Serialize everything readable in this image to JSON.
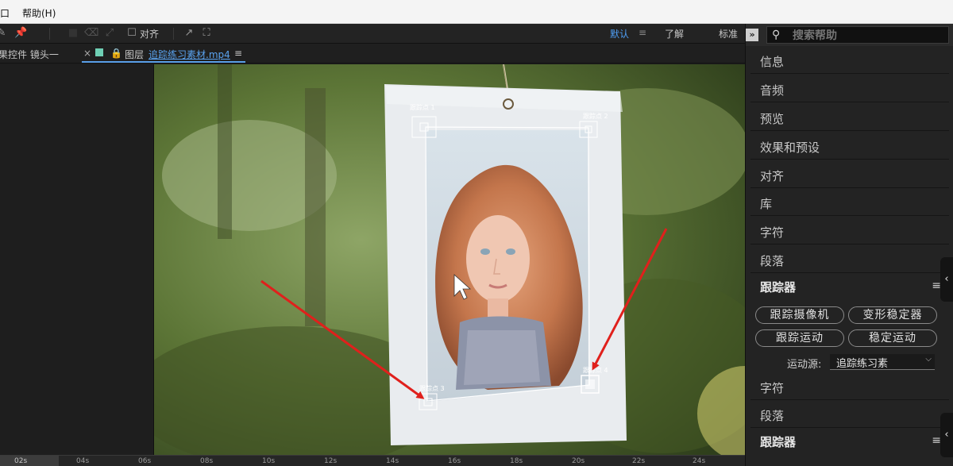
{
  "menubar": {
    "window": "窗口",
    "help": "帮助(H)"
  },
  "toolbar": {
    "align_label": "对齐",
    "workspaces": {
      "default": "默认",
      "learn": "了解",
      "standard": "标准"
    }
  },
  "tabs": {
    "left": "效果控件 镜头一",
    "layer_prefix": "图层",
    "layer_name": "追踪练习素材.mp4"
  },
  "viewer": {
    "track_points": [
      "跟踪点 1",
      "跟踪点 2",
      "跟踪点 3",
      "跟踪点 4"
    ]
  },
  "timeline": {
    "current": "02s",
    "ticks": [
      "04s",
      "06s",
      "08s",
      "10s",
      "12s",
      "14s",
      "16s",
      "18s",
      "20s",
      "22s",
      "24s"
    ]
  },
  "right_panel": {
    "search_placeholder": "搜索帮助",
    "items": [
      "信息",
      "音频",
      "预览",
      "效果和预设",
      "对齐",
      "库",
      "字符",
      "段落"
    ],
    "tracker": {
      "title": "跟踪器",
      "buttons": [
        "跟踪摄像机",
        "变形稳定器",
        "跟踪运动",
        "稳定运动"
      ],
      "motion_source_label": "运动源:",
      "motion_source_value": "追踪练习素"
    },
    "items_after": [
      "字符",
      "段落"
    ],
    "tracker2_title": "跟踪器"
  },
  "colors": {
    "accent": "#4f9ff5",
    "arrow": "#e0201c"
  }
}
